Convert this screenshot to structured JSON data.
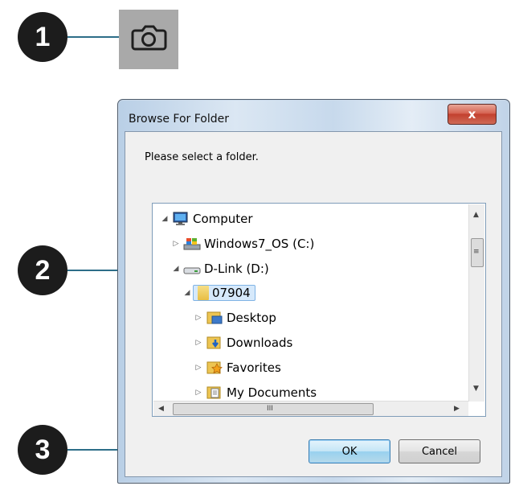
{
  "callouts": [
    "1",
    "2",
    "3"
  ],
  "dialog": {
    "title": "Browse For Folder",
    "close_glyph": "x",
    "prompt": "Please select a folder.",
    "tree": [
      {
        "label": "Computer",
        "icon": "computer-icon",
        "expander": "◢"
      },
      {
        "label": "Windows7_OS (C:)",
        "icon": "drive-c-icon",
        "expander": "▷"
      },
      {
        "label": "D-Link (D:)",
        "icon": "removable-drive-icon",
        "expander": "◢"
      },
      {
        "label": "07904",
        "icon": "folder-icon",
        "expander": "◢",
        "selected": true
      },
      {
        "label": "Desktop",
        "icon": "desktop-folder-icon",
        "expander": "▷"
      },
      {
        "label": "Downloads",
        "icon": "downloads-folder-icon",
        "expander": "▷"
      },
      {
        "label": "Favorites",
        "icon": "favorites-folder-icon",
        "expander": "▷"
      },
      {
        "label": "My Documents",
        "icon": "documents-folder-icon",
        "expander": "▷"
      }
    ],
    "scroll_glyphs": {
      "up": "▲",
      "down": "▼",
      "left": "◀",
      "right": "▶",
      "grip": "≡",
      "hgrip": "III"
    },
    "ok_label": "OK",
    "cancel_label": "Cancel"
  },
  "colors": {
    "leader": "#2d6e88",
    "callout_bg": "#1c1c1c",
    "camera_bg": "#a9a9a9"
  }
}
